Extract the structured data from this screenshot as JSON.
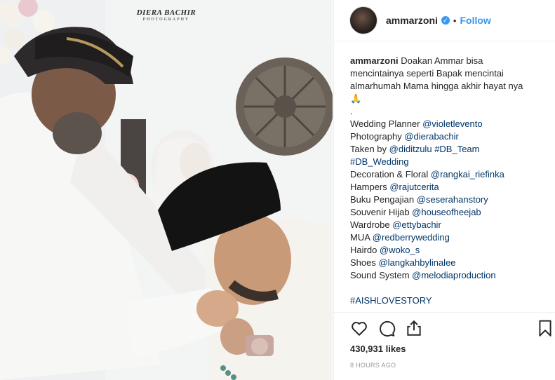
{
  "photo": {
    "watermark_main": "DIERA BACHIR",
    "watermark_sub": "PHOTOGRAPHY"
  },
  "post": {
    "username": "ammarzoni",
    "follow_label": "Follow",
    "separator": "•",
    "verified_glyph": "✓"
  },
  "caption": {
    "username": "ammarzoni",
    "lines": [
      "Doakan Ammar bisa",
      "mencintainya seperti Bapak mencintai",
      "almarhumah Mama hingga akhir hayat nya",
      "🙏",
      "."
    ],
    "credits": [
      {
        "label": "Wedding Planner ",
        "handle": "@violetlevento"
      },
      {
        "label": "Photography ",
        "handle": "@dierabachir"
      },
      {
        "label": "Taken by ",
        "handle": "@diditzulu",
        "extra": "#DB_Team"
      },
      {
        "label": "",
        "handle": "#DB_Wedding"
      },
      {
        "label": "Decoration & Floral ",
        "handle": "@rangkai_riefinka"
      },
      {
        "label": "Hampers ",
        "handle": "@rajutcerita"
      },
      {
        "label": "Buku Pengajian ",
        "handle": "@seserahanstory"
      },
      {
        "label": "Souvenir Hijab ",
        "handle": "@houseofheejab"
      },
      {
        "label": "Wardrobe ",
        "handle": "@ettybachir"
      },
      {
        "label": "MUA ",
        "handle": "@redberrywedding"
      },
      {
        "label": "Hairdo ",
        "handle": "@woko_s"
      },
      {
        "label": "Shoes ",
        "handle": "@langkahbylinalee"
      },
      {
        "label": "Sound System ",
        "handle": "@melodiaproduction"
      }
    ],
    "final_hashtag": "#AISHLOVESTORY"
  },
  "stats": {
    "likes": "430,931 likes",
    "time": "8 HOURS AGO"
  },
  "icons": [
    "heart-icon",
    "comment-icon",
    "share-icon",
    "bookmark-icon"
  ],
  "colors": {
    "link": "#003569",
    "follow": "#3897f0",
    "text": "#262626",
    "muted": "#999999"
  }
}
